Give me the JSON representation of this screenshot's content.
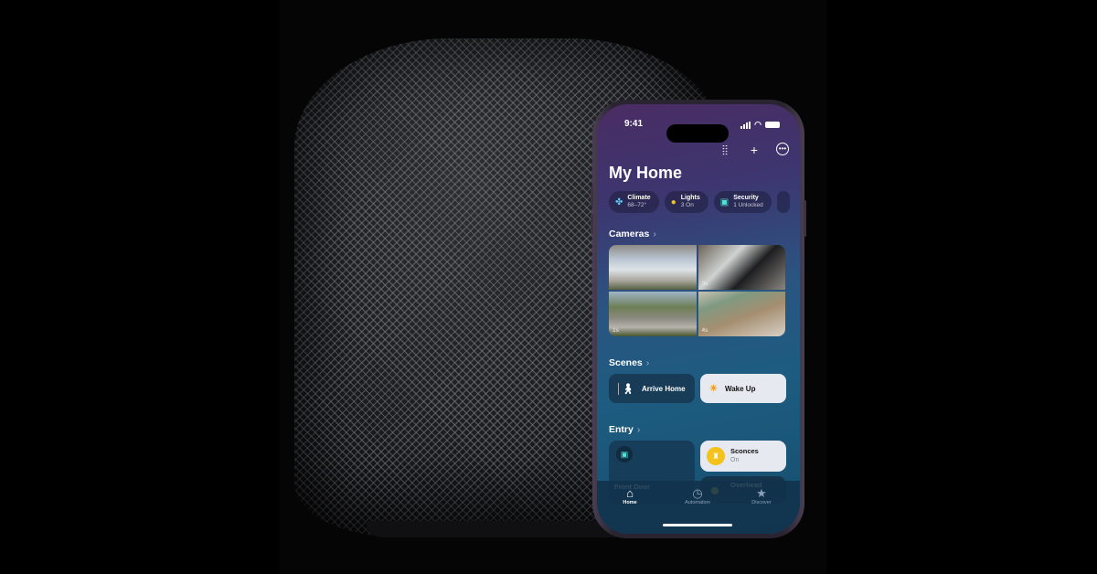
{
  "status_bar": {
    "time": "9:41"
  },
  "toolbar": {
    "icons": [
      "waveform-icon",
      "plus-icon",
      "more-icon"
    ]
  },
  "page": {
    "title": "My Home"
  },
  "pills": [
    {
      "icon": "fan-icon",
      "title": "Climate",
      "subtitle": "68–72°",
      "color": "#5bc8f5"
    },
    {
      "icon": "bulb-icon",
      "title": "Lights",
      "subtitle": "3 On",
      "color": "#f3c21b"
    },
    {
      "icon": "lock-icon",
      "title": "Security",
      "subtitle": "1 Unlocked",
      "color": "#53e0d6"
    }
  ],
  "sections": {
    "cameras": "Cameras",
    "scenes": "Scenes",
    "entry": "Entry"
  },
  "cameras": [
    {
      "label": ""
    },
    {
      "label": "3s"
    },
    {
      "label": "1s"
    },
    {
      "label": "4s"
    }
  ],
  "scenes": [
    {
      "label": "Arrive Home",
      "icon": "walking-person-icon"
    },
    {
      "label": "Wake Up",
      "icon": "sunrise-icon"
    }
  ],
  "accessories": {
    "front_door": {
      "name": "Front Door"
    },
    "sconces": {
      "name": "Sconces",
      "state": "On"
    },
    "overhead": {
      "name": "Overhead"
    }
  },
  "tabbar": [
    {
      "label": "Home",
      "active": true
    },
    {
      "label": "Automation",
      "active": false
    },
    {
      "label": "Discover",
      "active": false
    }
  ]
}
